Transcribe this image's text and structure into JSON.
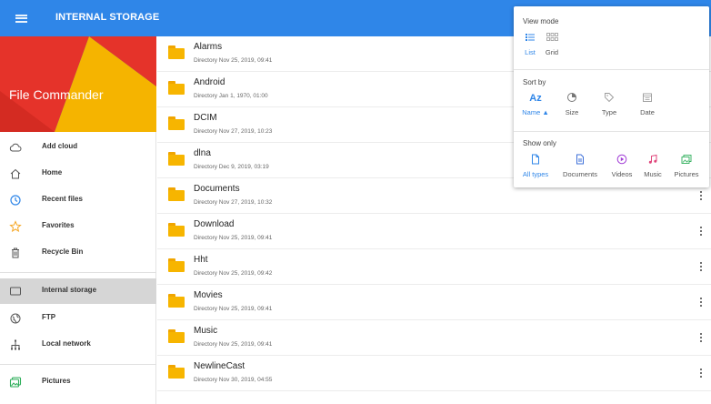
{
  "colors": {
    "accent": "#2f86e8",
    "folder": "#f7b500",
    "banner_red": "#e5332a",
    "banner_blue": "#1f7ad8",
    "banner_yellow": "#f5b400"
  },
  "topbar": {
    "title": "INTERNAL STORAGE",
    "menu_icon": "hamburger-icon"
  },
  "sidebar": {
    "banner_title": "File Commander",
    "items": [
      {
        "label": "Add cloud",
        "icon": "cloud-icon"
      },
      {
        "label": "Home",
        "icon": "home-icon"
      },
      {
        "label": "Recent files",
        "icon": "clock-icon"
      },
      {
        "label": "Favorites",
        "icon": "star-icon"
      },
      {
        "label": "Recycle Bin",
        "icon": "trash-icon"
      },
      {
        "label": "Internal storage",
        "icon": "tablet-icon",
        "active": true
      },
      {
        "label": "FTP",
        "icon": "globe-icon"
      },
      {
        "label": "Local network",
        "icon": "network-icon"
      },
      {
        "label": "Pictures",
        "icon": "pictures-icon"
      }
    ]
  },
  "files": [
    {
      "name": "Alarms",
      "meta": "Directory   Nov 25, 2019, 09:41"
    },
    {
      "name": "Android",
      "meta": "Directory   Jan 1, 1970, 01:00"
    },
    {
      "name": "DCIM",
      "meta": "Directory   Nov 27, 2019, 10:23"
    },
    {
      "name": "dlna",
      "meta": "Directory   Dec 9, 2019, 03:19"
    },
    {
      "name": "Documents",
      "meta": "Directory   Nov 27, 2019, 10:32"
    },
    {
      "name": "Download",
      "meta": "Directory   Nov 25, 2019, 09:41"
    },
    {
      "name": "Hht",
      "meta": "Directory   Nov 25, 2019, 09:42"
    },
    {
      "name": "Movies",
      "meta": "Directory   Nov 25, 2019, 09:41"
    },
    {
      "name": "Music",
      "meta": "Directory   Nov 25, 2019, 09:41"
    },
    {
      "name": "NewlineCast",
      "meta": "Directory   Nov 30, 2019, 04:55"
    }
  ],
  "popup": {
    "view_mode": {
      "title": "View mode",
      "options": [
        {
          "label": "List",
          "icon": "list-icon",
          "selected": true
        },
        {
          "label": "Grid",
          "icon": "grid-icon",
          "selected": false
        }
      ]
    },
    "sort_by": {
      "title": "Sort by",
      "options": [
        {
          "label": "Name ▲",
          "icon": "sort-az-icon",
          "glyph": "Az",
          "selected": true
        },
        {
          "label": "Size",
          "icon": "pie-icon",
          "selected": false
        },
        {
          "label": "Type",
          "icon": "tag-icon",
          "selected": false
        },
        {
          "label": "Date",
          "icon": "calendar-icon",
          "selected": false
        }
      ]
    },
    "show_only": {
      "title": "Show only",
      "options": [
        {
          "label": "All types",
          "icon": "file-icon",
          "selected": true
        },
        {
          "label": "Documents",
          "icon": "document-icon",
          "selected": false
        },
        {
          "label": "Videos",
          "icon": "video-icon",
          "selected": false
        },
        {
          "label": "Music",
          "icon": "music-icon",
          "selected": false
        },
        {
          "label": "Pictures",
          "icon": "picture-icon",
          "selected": false
        }
      ]
    }
  }
}
